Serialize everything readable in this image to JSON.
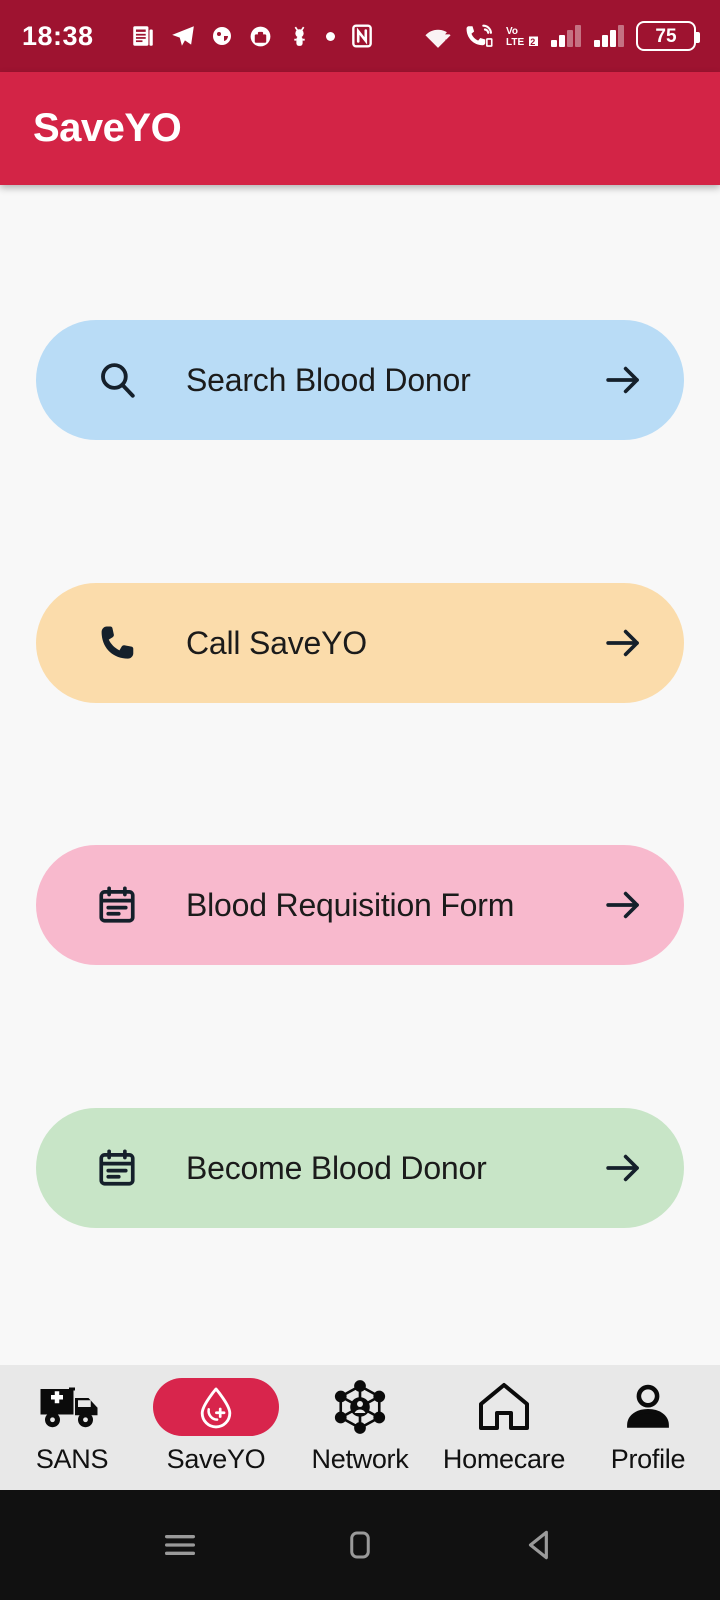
{
  "statusbar": {
    "time": "18:38",
    "battery_level": "75",
    "left_icons": [
      "news-icon",
      "telegram-icon",
      "sticker-icon",
      "briefcase-icon",
      "scooter-icon",
      "dot-icon",
      "nfc-icon"
    ],
    "right_icons": [
      "wifi-icon",
      "wifi-calling-icon",
      "volte2-icon",
      "signal-bars-sim1-icon",
      "signal-bars-sim2-icon",
      "battery-icon"
    ]
  },
  "appbar": {
    "title": "SaveYO"
  },
  "cards": [
    {
      "label": "Search Blood Donor",
      "icon": "search-icon",
      "bg": "#b9dcf6",
      "name": "search-blood-donor"
    },
    {
      "label": "Call SaveYO",
      "icon": "phone-icon",
      "bg": "#fbdcab",
      "name": "call-saveyo"
    },
    {
      "label": "Blood Requisition Form",
      "icon": "form-icon",
      "bg": "#f8b9cd",
      "name": "blood-requisition-form"
    },
    {
      "label": "Become Blood Donor",
      "icon": "form-icon",
      "bg": "#c8e5c7",
      "name": "become-blood-donor"
    }
  ],
  "bottom_nav": {
    "active_index": 1,
    "active_pill_color": "#d8254c",
    "items": [
      {
        "label": "SANS",
        "icon": "ambulance-icon"
      },
      {
        "label": "SaveYO",
        "icon": "blood-drop-plus-icon"
      },
      {
        "label": "Network",
        "icon": "network-nodes-icon"
      },
      {
        "label": "Homecare",
        "icon": "home-icon"
      },
      {
        "label": "Profile",
        "icon": "person-icon"
      }
    ]
  },
  "system_nav": {
    "buttons": [
      "recents-icon",
      "home-icon",
      "back-icon"
    ]
  },
  "theme": {
    "statusbar_bg": "#9e1330",
    "appbar_bg": "#d32446",
    "page_bg": "#f8f8f8",
    "nav_bg": "#e8e8e8",
    "sysnav_bg": "#111111"
  }
}
